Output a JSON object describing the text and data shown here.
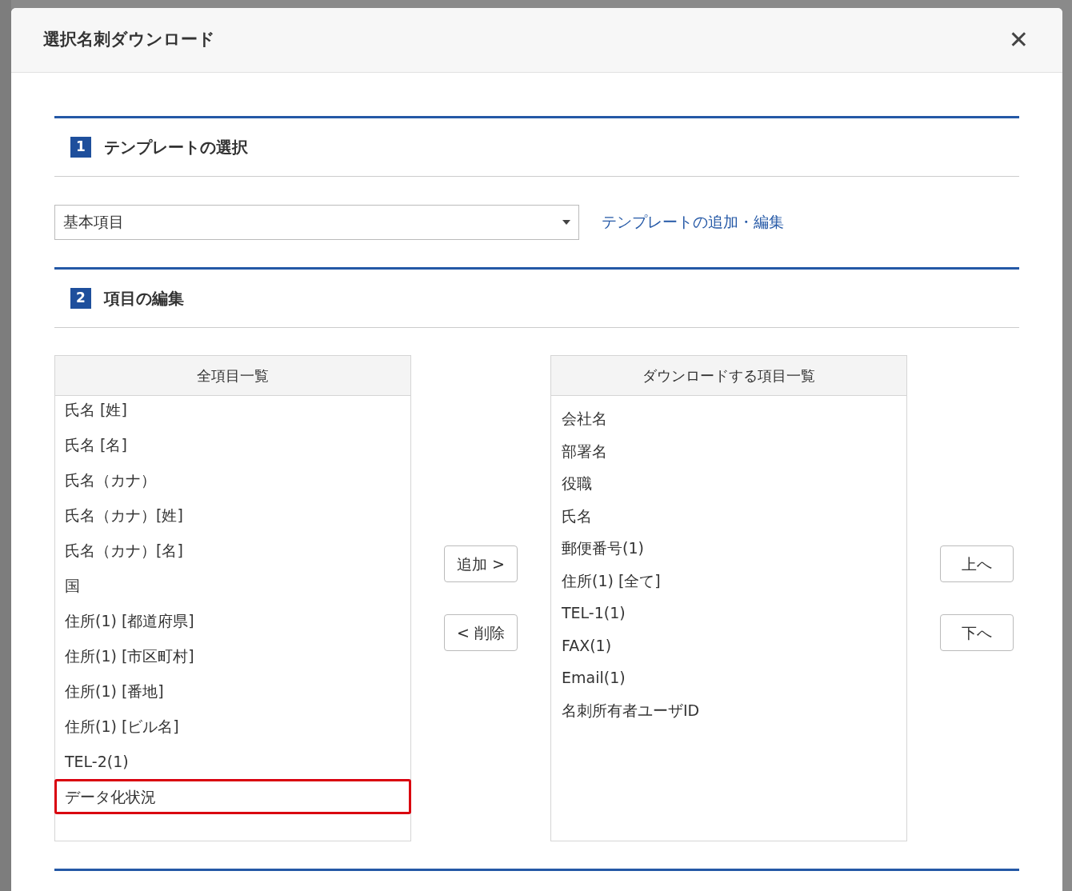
{
  "dialog": {
    "title": "選択名刺ダウンロード",
    "close": "✕"
  },
  "sections": [
    {
      "number": "1",
      "title": "テンプレートの選択"
    },
    {
      "number": "2",
      "title": "項目の編集"
    }
  ],
  "template": {
    "value": "基本項目",
    "link": "テンプレートの追加・編集"
  },
  "all_items": {
    "header": "全項目一覧",
    "items": [
      {
        "label": "氏名 [姓]",
        "highlighted": false
      },
      {
        "label": "氏名 [名]",
        "highlighted": false
      },
      {
        "label": "氏名（カナ）",
        "highlighted": false
      },
      {
        "label": "氏名（カナ）[姓]",
        "highlighted": false
      },
      {
        "label": "氏名（カナ）[名]",
        "highlighted": false
      },
      {
        "label": "国",
        "highlighted": false
      },
      {
        "label": "住所(1) [都道府県]",
        "highlighted": false
      },
      {
        "label": "住所(1) [市区町村]",
        "highlighted": false
      },
      {
        "label": "住所(1) [番地]",
        "highlighted": false
      },
      {
        "label": "住所(1) [ビル名]",
        "highlighted": false
      },
      {
        "label": "TEL-2(1)",
        "highlighted": false
      },
      {
        "label": "データ化状況",
        "highlighted": true
      }
    ]
  },
  "move_buttons": [
    "追加 >",
    "< 削除"
  ],
  "download_items": {
    "header": "ダウンロードする項目一覧",
    "items": [
      "会社名",
      "部署名",
      "役職",
      "氏名",
      "郵便番号(1)",
      "住所(1) [全て]",
      "TEL-1(1)",
      "FAX(1)",
      "Email(1)",
      "名刺所有者ユーザID"
    ]
  },
  "order_buttons": [
    "上へ",
    "下へ"
  ]
}
